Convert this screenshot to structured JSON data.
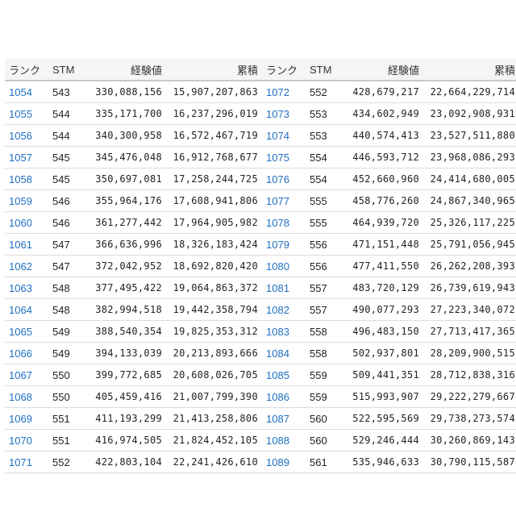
{
  "headers": {
    "rank": "ランク",
    "stm": "STM",
    "exp": "経験値",
    "total": "累積"
  },
  "colors": {
    "rank_link": "#1e6fc2",
    "header_bg": "#f5f5f5",
    "row_border": "#dddddd"
  },
  "left_table": [
    {
      "rank": "1054",
      "stm": "543",
      "exp": "330,088,156",
      "total": "15,907,207,863"
    },
    {
      "rank": "1055",
      "stm": "544",
      "exp": "335,171,700",
      "total": "16,237,296,019"
    },
    {
      "rank": "1056",
      "stm": "544",
      "exp": "340,300,958",
      "total": "16,572,467,719"
    },
    {
      "rank": "1057",
      "stm": "545",
      "exp": "345,476,048",
      "total": "16,912,768,677"
    },
    {
      "rank": "1058",
      "stm": "545",
      "exp": "350,697,081",
      "total": "17,258,244,725"
    },
    {
      "rank": "1059",
      "stm": "546",
      "exp": "355,964,176",
      "total": "17,608,941,806"
    },
    {
      "rank": "1060",
      "stm": "546",
      "exp": "361,277,442",
      "total": "17,964,905,982"
    },
    {
      "rank": "1061",
      "stm": "547",
      "exp": "366,636,996",
      "total": "18,326,183,424"
    },
    {
      "rank": "1062",
      "stm": "547",
      "exp": "372,042,952",
      "total": "18,692,820,420"
    },
    {
      "rank": "1063",
      "stm": "548",
      "exp": "377,495,422",
      "total": "19,064,863,372"
    },
    {
      "rank": "1064",
      "stm": "548",
      "exp": "382,994,518",
      "total": "19,442,358,794"
    },
    {
      "rank": "1065",
      "stm": "549",
      "exp": "388,540,354",
      "total": "19,825,353,312"
    },
    {
      "rank": "1066",
      "stm": "549",
      "exp": "394,133,039",
      "total": "20,213,893,666"
    },
    {
      "rank": "1067",
      "stm": "550",
      "exp": "399,772,685",
      "total": "20,608,026,705"
    },
    {
      "rank": "1068",
      "stm": "550",
      "exp": "405,459,416",
      "total": "21,007,799,390"
    },
    {
      "rank": "1069",
      "stm": "551",
      "exp": "411,193,299",
      "total": "21,413,258,806"
    },
    {
      "rank": "1070",
      "stm": "551",
      "exp": "416,974,505",
      "total": "21,824,452,105"
    },
    {
      "rank": "1071",
      "stm": "552",
      "exp": "422,803,104",
      "total": "22,241,426,610"
    }
  ],
  "right_table": [
    {
      "rank": "1072",
      "stm": "552",
      "exp": "428,679,217",
      "total": "22,664,229,714"
    },
    {
      "rank": "1073",
      "stm": "553",
      "exp": "434,602,949",
      "total": "23,092,908,931"
    },
    {
      "rank": "1074",
      "stm": "553",
      "exp": "440,574,413",
      "total": "23,527,511,880"
    },
    {
      "rank": "1075",
      "stm": "554",
      "exp": "446,593,712",
      "total": "23,968,086,293"
    },
    {
      "rank": "1076",
      "stm": "554",
      "exp": "452,660,960",
      "total": "24,414,680,005"
    },
    {
      "rank": "1077",
      "stm": "555",
      "exp": "458,776,260",
      "total": "24,867,340,965"
    },
    {
      "rank": "1078",
      "stm": "555",
      "exp": "464,939,720",
      "total": "25,326,117,225"
    },
    {
      "rank": "1079",
      "stm": "556",
      "exp": "471,151,448",
      "total": "25,791,056,945"
    },
    {
      "rank": "1080",
      "stm": "556",
      "exp": "477,411,550",
      "total": "26,262,208,393"
    },
    {
      "rank": "1081",
      "stm": "557",
      "exp": "483,720,129",
      "total": "26,739,619,943"
    },
    {
      "rank": "1082",
      "stm": "557",
      "exp": "490,077,293",
      "total": "27,223,340,072"
    },
    {
      "rank": "1083",
      "stm": "558",
      "exp": "496,483,150",
      "total": "27,713,417,365"
    },
    {
      "rank": "1084",
      "stm": "558",
      "exp": "502,937,801",
      "total": "28,209,900,515"
    },
    {
      "rank": "1085",
      "stm": "559",
      "exp": "509,441,351",
      "total": "28,712,838,316"
    },
    {
      "rank": "1086",
      "stm": "559",
      "exp": "515,993,907",
      "total": "29,222,279,667"
    },
    {
      "rank": "1087",
      "stm": "560",
      "exp": "522,595,569",
      "total": "29,738,273,574"
    },
    {
      "rank": "1088",
      "stm": "560",
      "exp": "529,246,444",
      "total": "30,260,869,143"
    },
    {
      "rank": "1089",
      "stm": "561",
      "exp": "535,946,633",
      "total": "30,790,115,587"
    }
  ]
}
